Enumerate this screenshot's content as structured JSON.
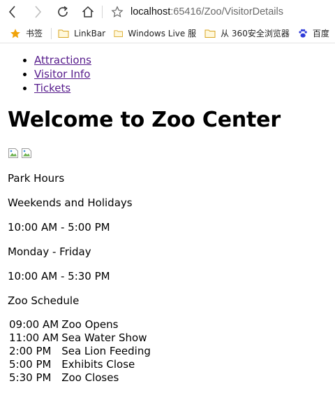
{
  "browser": {
    "url_host": "localhost",
    "url_path": ":65416/Zoo/VisitorDetails",
    "bookmarks": [
      {
        "label": "书签",
        "icon": "star-icon"
      },
      {
        "label": "LinkBar",
        "icon": "folder-icon"
      },
      {
        "label": "Windows Live 服",
        "icon": "folder-icon"
      },
      {
        "label": "从 360安全浏览器",
        "icon": "folder-icon"
      },
      {
        "label": "百度",
        "icon": "baidu-paw-icon"
      }
    ]
  },
  "nav": {
    "items": [
      "Attractions",
      "Visitor Info",
      "Tickets"
    ]
  },
  "page": {
    "title": "Welcome to Zoo Center",
    "park_hours_heading": "Park Hours",
    "weekend_label": "Weekends and Holidays",
    "weekend_hours": "10:00 AM - 5:00 PM",
    "weekday_label": "Monday - Friday",
    "weekday_hours": "10:00 AM - 5:30 PM",
    "schedule_heading": "Zoo Schedule",
    "schedule": [
      {
        "time": "09:00 AM",
        "event": "Zoo Opens"
      },
      {
        "time": "11:00 AM",
        "event": "Sea Water Show"
      },
      {
        "time": "2:00 PM",
        "event": "Sea Lion Feeding"
      },
      {
        "time": "5:00 PM",
        "event": "Exhibits Close"
      },
      {
        "time": "5:30 PM",
        "event": "Zoo Closes"
      }
    ]
  },
  "colors": {
    "link_visited": "#551a8b",
    "bookmark_star": "#f0a30a",
    "folder": "#f2c94c"
  }
}
